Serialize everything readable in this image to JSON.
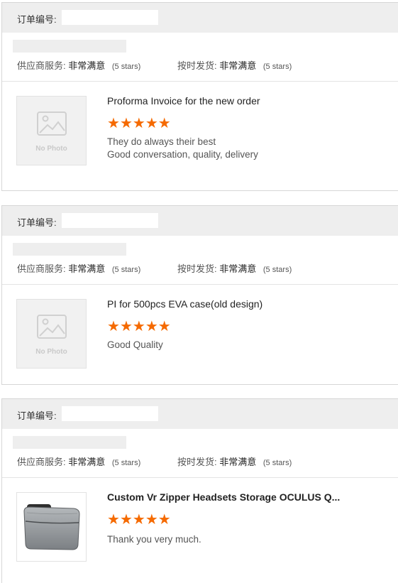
{
  "reviews": [
    {
      "order_label": "订单编号:",
      "order_value": "",
      "supplier_label": "供应商服务:",
      "supplier_rating": "非常满意",
      "supplier_stars": "(5 stars)",
      "ship_label": "按时发货:",
      "ship_rating": "非常满意",
      "ship_stars": "(5 stars)",
      "image": "no-photo-placeholder",
      "placeholder_text": "No Photo",
      "title": "Proforma Invoice for the new order",
      "rating": 5,
      "comments": [
        "They do always their best",
        "Good conversation, quality, delivery"
      ]
    },
    {
      "order_label": "订单编号:",
      "order_value": "",
      "supplier_label": "供应商服务:",
      "supplier_rating": "非常满意",
      "supplier_stars": "(5 stars)",
      "ship_label": "按时发货:",
      "ship_rating": "非常满意",
      "ship_stars": "(5 stars)",
      "image": "no-photo-placeholder",
      "placeholder_text": "No Photo",
      "title": "PI for 500pcs EVA case(old design)",
      "rating": 5,
      "comments": [
        "Good Quality"
      ]
    },
    {
      "order_label": "订单编号:",
      "order_value": "",
      "supplier_label": "供应商服务:",
      "supplier_rating": "非常满意",
      "supplier_stars": "(5 stars)",
      "ship_label": "按时发货:",
      "ship_rating": "非常满意",
      "ship_stars": "(5 stars)",
      "image": "gray-vr-headset-case-photo",
      "title": "Custom Vr Zipper Headsets Storage OCULUS Q...",
      "rating": 5,
      "comments": [
        "Thank you very much."
      ]
    }
  ],
  "colors": {
    "star": "#f56a00",
    "header_bg": "#eeeeee",
    "border": "#d6d6d6"
  }
}
